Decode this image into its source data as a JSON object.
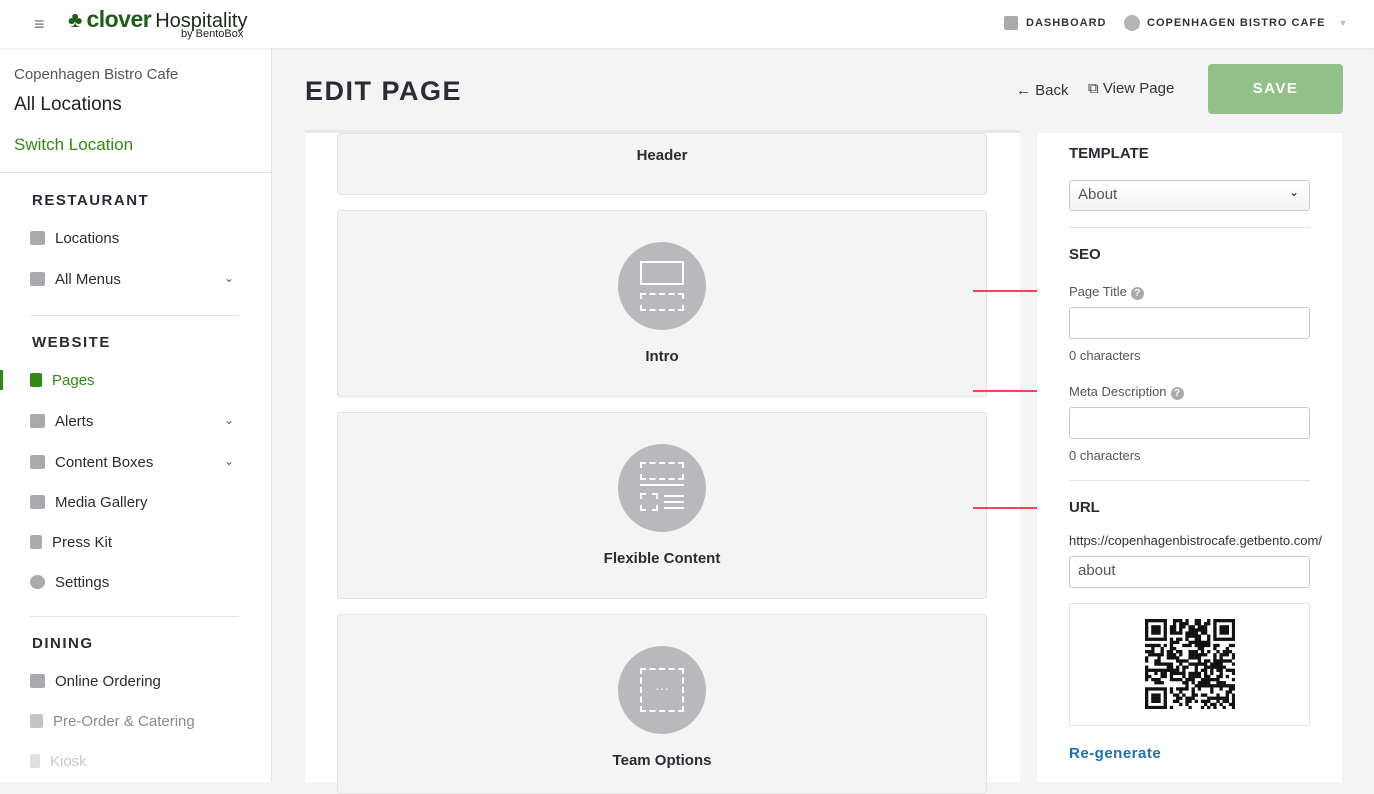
{
  "topbar": {
    "logo_word": "clover",
    "logo_brand": "Hospitality",
    "logo_sub": "by BentoBox",
    "dashboard": "DASHBOARD",
    "account": "COPENHAGEN BISTRO CAFE"
  },
  "sidebar": {
    "location": "Copenhagen Bistro Cafe",
    "all_locations": "All Locations",
    "switch": "Switch Location",
    "restaurant": "RESTAURANT",
    "locations": "Locations",
    "all_menus": "All Menus",
    "website": "WEBSITE",
    "pages": "Pages",
    "alerts": "Alerts",
    "content_boxes": "Content Boxes",
    "media_gallery": "Media Gallery",
    "press_kit": "Press Kit",
    "settings": "Settings",
    "dining": "DINING",
    "online_ordering": "Online Ordering",
    "preorder": "Pre-Order & Catering",
    "kiosk": "Kiosk"
  },
  "main": {
    "title": "EDIT PAGE",
    "back": "Back",
    "view_page": "View Page",
    "save": "SAVE",
    "blocks": [
      "Header",
      "Intro",
      "Flexible Content",
      "Team Options"
    ]
  },
  "panel": {
    "template_label": "TEMPLATE",
    "template_value": "About",
    "seo": "SEO",
    "page_title": "Page Title",
    "page_title_count": "0 characters",
    "meta": "Meta Description",
    "meta_count": "0 characters",
    "url": "URL",
    "url_prefix": "https://copenhagenbistrocafe.getbento.com/",
    "url_value": "about",
    "regenerate": "Re-generate"
  },
  "colors": {
    "green": "#2e8b14",
    "save": "#93c088",
    "arrow": "#f0445f",
    "link": "#1f6fb5"
  }
}
